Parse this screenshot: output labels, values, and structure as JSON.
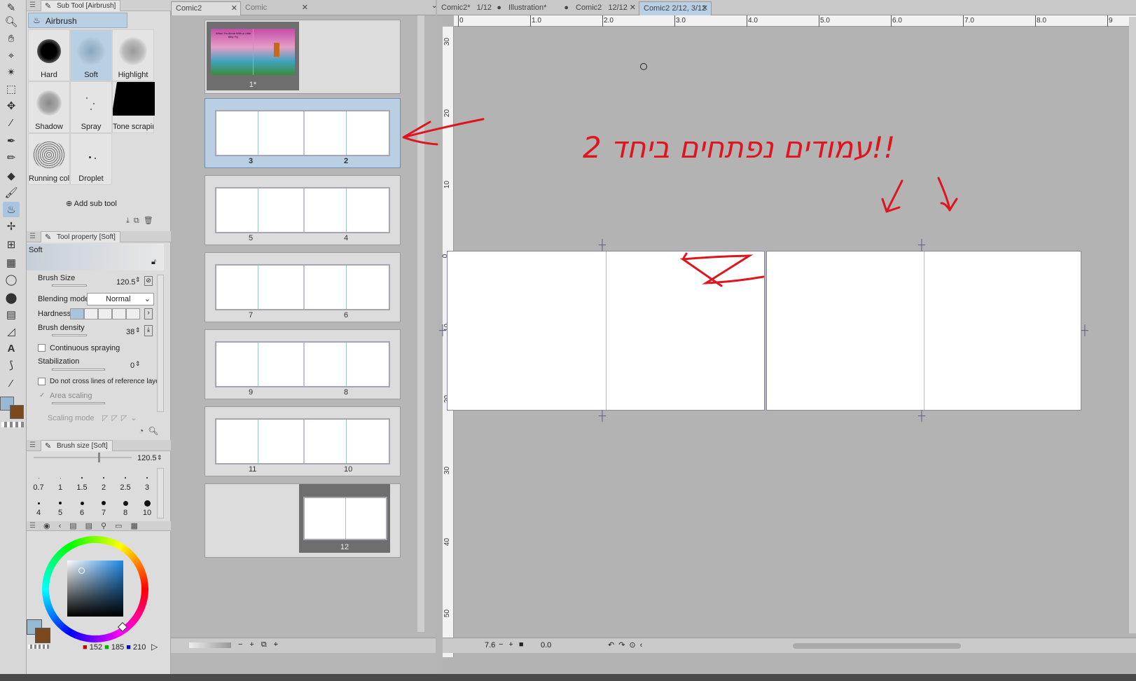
{
  "sub_tool_panel": {
    "tab_label": "Sub Tool [Airbrush]",
    "group_label": "Airbrush",
    "brushes": [
      "Hard",
      "Soft",
      "Highlight",
      "Shadow",
      "Spray",
      "Tone scrapir",
      "Running col",
      "Droplet"
    ],
    "add_label": "Add sub tool"
  },
  "tool_property": {
    "tab_label": "Tool property [Soft]",
    "preset_name": "Soft",
    "brush_size_label": "Brush Size",
    "brush_size_value": "120.5",
    "blending_label": "Blending mode",
    "blending_value": "Normal",
    "hardness_label": "Hardness",
    "density_label": "Brush density",
    "density_value": "38",
    "continuous_label": "Continuous spraying",
    "stabilization_label": "Stabilization",
    "stabilization_value": "0",
    "no_cross_label": "Do not cross lines of reference layer",
    "area_scaling_label": "Area scaling",
    "scaling_mode_label": "Scaling mode"
  },
  "brush_size_panel": {
    "tab_label": "Brush size [Soft]",
    "value": "120.5",
    "sizes_row1": [
      "0.7",
      "1",
      "1.5",
      "2",
      "2.5",
      "3"
    ],
    "sizes_row2": [
      "4",
      "5",
      "6",
      "7",
      "8",
      "10"
    ]
  },
  "color_panel": {
    "r": "152",
    "g": "185",
    "b": "210",
    "main_color": "#98b9d2",
    "sub_color": "#7a4a1e"
  },
  "page_manager": {
    "tabs": [
      {
        "label": "Comic2",
        "closable": true
      },
      {
        "label": "Comic",
        "closable": true
      }
    ],
    "cover_label": "1*",
    "cover_text": "When I'm Alone With a Little Bitty Fly",
    "spreads": [
      {
        "left": "3",
        "right": "2",
        "selected": true
      },
      {
        "left": "5",
        "right": "4",
        "selected": false
      },
      {
        "left": "7",
        "right": "6",
        "selected": false
      },
      {
        "left": "9",
        "right": "8",
        "selected": false
      },
      {
        "left": "11",
        "right": "10",
        "selected": false
      }
    ],
    "last_page": "12"
  },
  "canvas_tabs": [
    {
      "title": "Comic2*",
      "page": "1/12",
      "mark": "●",
      "active": false
    },
    {
      "title": "Illustration*",
      "page": "",
      "mark": "●",
      "active": false
    },
    {
      "title": "Comic2",
      "page": "12/12",
      "mark": "✕",
      "active": false
    },
    {
      "title": "Comic2 2/12, 3/12",
      "page": "",
      "mark": "✕",
      "active": true
    }
  ],
  "ruler_h": [
    "0",
    "1.0",
    "2.0",
    "3.0",
    "4.0",
    "5.0",
    "6.0",
    "7.0",
    "8.0",
    "9"
  ],
  "ruler_v": [
    "30",
    "20",
    "10",
    "0",
    "10",
    "20",
    "30",
    "40",
    "50"
  ],
  "annotation": {
    "hebrew_text": "2 עמודים נפתחים ביחד!!",
    "color": "#e0141e"
  },
  "canvas_status": {
    "zoom": "7.6",
    "angle": "0.0"
  }
}
